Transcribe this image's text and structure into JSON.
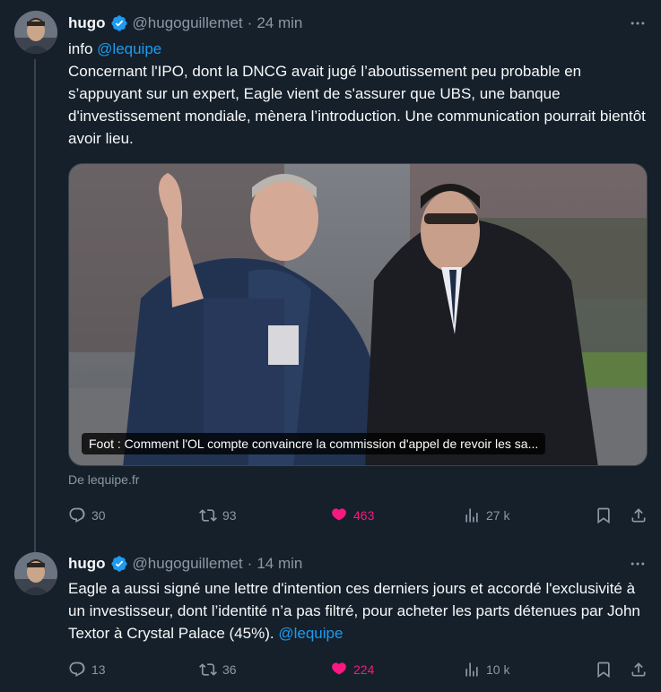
{
  "colors": {
    "background": "#15202b",
    "text": "#f7f9f9",
    "secondary": "#8b98a5",
    "accent": "#1d9bf0",
    "like": "#f91880"
  },
  "tweets": [
    {
      "author_name": "hugo",
      "handle": "@hugoguillemet",
      "separator": "·",
      "time": "24 min",
      "mention_prefix": "info",
      "mention": "@lequipe",
      "body": "Concernant l'IPO, dont la DNCG avait jugé l’aboutissement peu probable en s’appuyant sur un expert, Eagle vient de s'assurer que UBS, une banque d'investissement mondiale, mènera l’introduction. Une communication pourrait bientôt avoir lieu.",
      "media_caption": "Foot : Comment l'OL compte convaincre la commission d'appel de revoir les sa...",
      "media_source": "De lequipe.fr",
      "replies": "30",
      "retweets": "93",
      "likes": "463",
      "views": "27 k",
      "icons": [
        "verified-badge-icon",
        "more-icon",
        "reply-icon",
        "retweet-icon",
        "heart-filled-icon",
        "views-icon",
        "bookmark-icon",
        "share-icon"
      ]
    },
    {
      "author_name": "hugo",
      "handle": "@hugoguillemet",
      "separator": "·",
      "time": "14 min",
      "body": "Eagle a aussi signé une lettre d'intention ces derniers jours et accordé l'exclusivité à un investisseur, dont l’identité n’a pas filtré, pour acheter les parts détenues par John Textor à Crystal Palace (45%).",
      "mention": "@lequipe",
      "replies": "13",
      "retweets": "36",
      "likes": "224",
      "views": "10 k"
    }
  ]
}
